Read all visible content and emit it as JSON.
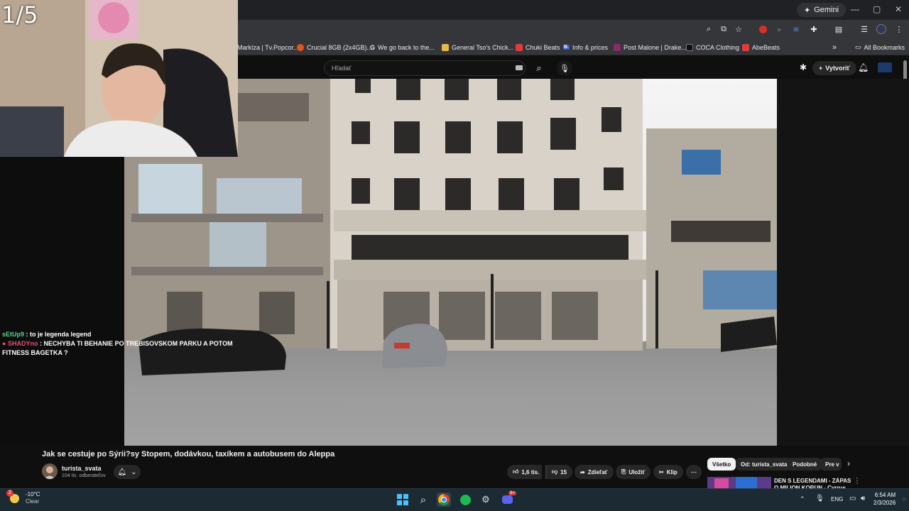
{
  "browser": {
    "gemini_label": "Gemini",
    "bookmarks": [
      {
        "label": "Markíza | Tv.Popcor...",
        "color": "#2a2a2a"
      },
      {
        "label": "Crucial 8GB (2x4GB)...",
        "color": "#e8541a"
      },
      {
        "label": "We go back to the...",
        "color": "#ffffff",
        "icon_text": "G"
      },
      {
        "label": "General Tso's Chick...",
        "color": "#e8b84a"
      },
      {
        "label": "Chuki Beats",
        "color": "#e23a3a"
      },
      {
        "label": "Info & prices",
        "color": "#2b5bd8",
        "icon_text": "B."
      },
      {
        "label": "Post Malone | Drake...",
        "color": "#8a2a6a"
      },
      {
        "label": "COCA Clothing",
        "color": "#111111"
      },
      {
        "label": "AbeBeats",
        "color": "#e23a3a"
      }
    ],
    "all_bookmarks": "All Bookmarks"
  },
  "youtube": {
    "search_placeholder": "Hľadať",
    "create_label": "Vytvoriť",
    "video_title": "Jak se cestuje po Sýrii?sy Stopem, dodávkou, taxíkem a autobusem do Aleppa",
    "channel_name": "turista_svata",
    "subscribers": "104 tis. odberateľov",
    "likes": "1,6 tis.",
    "dislikes": "15",
    "share": "Zdieľať",
    "save": "Uložiť",
    "clip": "Klip",
    "chips": [
      "Všetko",
      "Od: turista_svata",
      "Podobné",
      "Pre v"
    ],
    "next_video_title": "DEN S LEGENDAMI - ZÁPAS O MILION KORUN - Cyrrus..."
  },
  "stream": {
    "counter": "1/5",
    "chat": [
      {
        "user": "sEtUp9",
        "user_color": "#5ad48a",
        "text": "to je legenda legend"
      },
      {
        "user": "SHADYno",
        "user_color": "#e0516f",
        "text": "NECHYBA TI BEHANIE PO TREBISOVSKOM PARKU A POTOM FITNESS BAGETKA ?"
      }
    ]
  },
  "taskbar": {
    "temperature": "-10°C",
    "condition": "Clear",
    "weather_badge": "2",
    "lang": "ENG",
    "time": "6:54 AM",
    "date": "2/3/2026",
    "discord_badge": "9+"
  }
}
